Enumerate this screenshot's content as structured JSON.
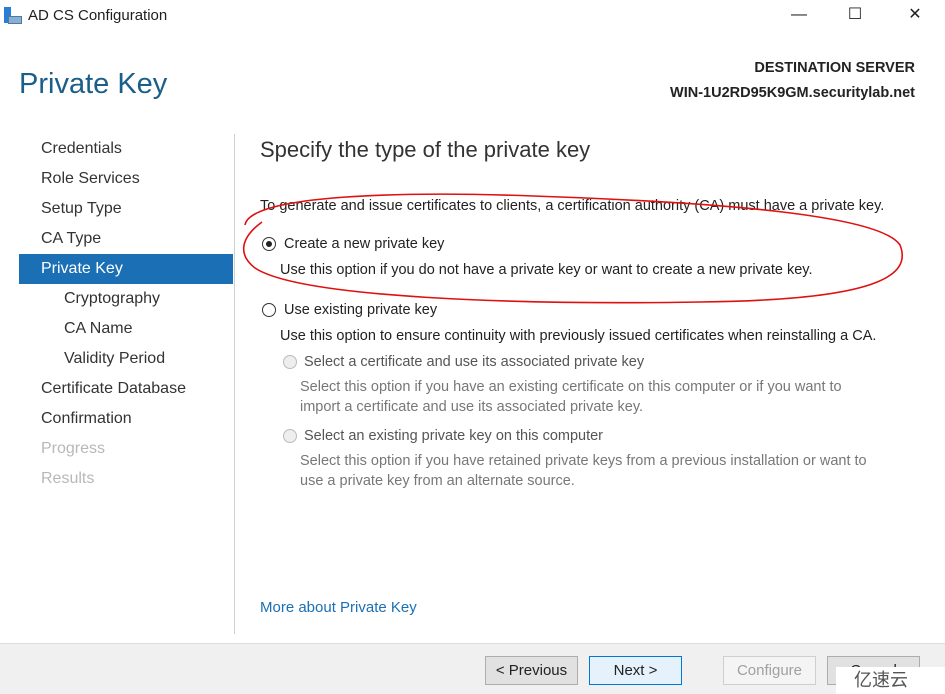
{
  "window": {
    "title": "AD CS Configuration",
    "controls": {
      "minimize": "—",
      "maximize": "☐",
      "close": "✕"
    }
  },
  "header": {
    "page_title": "Private Key",
    "destination_label": "DESTINATION SERVER",
    "destination_server": "WIN-1U2RD95K9GM.securitylab.net"
  },
  "nav": {
    "items": [
      {
        "label": "Credentials",
        "state": "normal"
      },
      {
        "label": "Role Services",
        "state": "normal"
      },
      {
        "label": "Setup Type",
        "state": "normal"
      },
      {
        "label": "CA Type",
        "state": "normal"
      },
      {
        "label": "Private Key",
        "state": "selected"
      },
      {
        "label": "Cryptography",
        "state": "sub"
      },
      {
        "label": "CA Name",
        "state": "sub"
      },
      {
        "label": "Validity Period",
        "state": "sub"
      },
      {
        "label": "Certificate Database",
        "state": "normal"
      },
      {
        "label": "Confirmation",
        "state": "normal"
      },
      {
        "label": "Progress",
        "state": "disabled"
      },
      {
        "label": "Results",
        "state": "disabled"
      }
    ]
  },
  "main": {
    "heading": "Specify the type of the private key",
    "intro": "To generate and issue certificates to clients, a certification authority (CA) must have a private key.",
    "option_new": {
      "label": "Create a new private key",
      "desc": "Use this option if you do not have a private key or want to create a new private key.",
      "selected": true
    },
    "option_existing": {
      "label": "Use existing private key",
      "desc": "Use this option to ensure continuity with previously issued certificates when reinstalling a CA.",
      "selected": false
    },
    "sub_cert": {
      "label": "Select a certificate and use its associated private key",
      "desc1": "Select this option if you have an existing certificate on this computer or if you want to",
      "desc2": "import a certificate and use its associated private key."
    },
    "sub_key": {
      "label": "Select an existing private key on this computer",
      "desc1": "Select this option if you have retained private keys from a previous installation or want to",
      "desc2": "use a private key from an alternate source."
    },
    "more_link": "More about Private Key"
  },
  "footer": {
    "previous": "< Previous",
    "next": "Next >",
    "configure": "Configure",
    "cancel": "Cancel"
  },
  "annotation_color": "#e01010",
  "watermark": "亿速云"
}
